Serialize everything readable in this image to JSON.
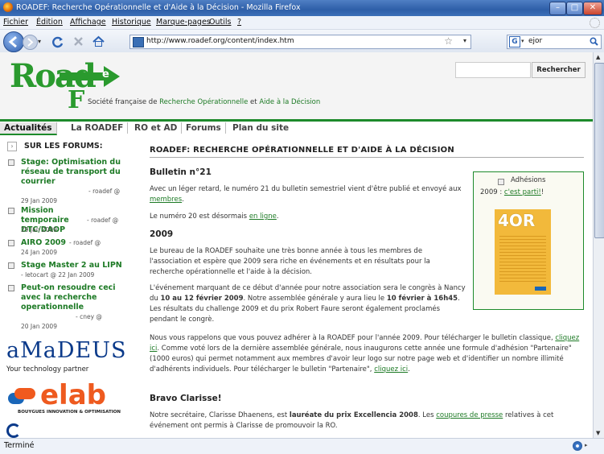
{
  "window": {
    "title": "ROADEF: Recherche Opérationnelle et d'Aide à la Décision - Mozilla Firefox",
    "controls": [
      "minimize",
      "maximize",
      "close"
    ]
  },
  "menu": {
    "items": [
      "Fichier",
      "Édition",
      "Affichage",
      "Historique",
      "Marque-pages",
      "Outils",
      "?"
    ]
  },
  "navbar": {
    "url": "http://www.roadef.org/content/index.htm",
    "search_value": "ejor"
  },
  "site": {
    "logo_text": "Road",
    "logo_letters": [
      "e",
      "F"
    ],
    "tagline_prefix": "Société française de ",
    "tagline_green1": "Recherche Opérationnelle",
    "tagline_mid": " et ",
    "tagline_green2": "Aide à la Décision",
    "search_button": "Rechercher"
  },
  "tabs": [
    "Actualités",
    "La ROADEF",
    "RO et AD",
    "Forums",
    "Plan du site"
  ],
  "sidebar": {
    "heading": "SUR LES FORUMS:",
    "items": [
      {
        "title": "Stage: Optimisation du réseau de transport du courrier",
        "author": " - roadef @",
        "date": "29 Jan 2009"
      },
      {
        "title": "Mission temporaire DTC/DAOP",
        "author": " - roadef @",
        "date": "29 Jan 2009"
      },
      {
        "title": "AIRO 2009",
        "author": " - roadef @",
        "date": "24 Jan 2009"
      },
      {
        "title": "Stage Master 2 au LIPN",
        "author": "- letocart @ 22 Jan 2009",
        "date": ""
      },
      {
        "title": "Peut-on resoudre ceci avec la recherche operationnelle",
        "author": " - cney @",
        "date": "20 Jan 2009"
      }
    ],
    "sponsor1": "aMaDEUS",
    "sponsor1_tag": "Your technology partner",
    "sponsor2": "elab",
    "sponsor2_tag": "BOUYGUES INNOVATION & OPTIMISATION"
  },
  "main": {
    "heading": "ROADEF: RECHERCHE OPÉRATIONNELLE ET D'AIDE À LA DÉCISION",
    "bulletin_title": "Bulletin n°21",
    "bulletin_p1a": "Avec un léger retard, le numéro 21 du bulletin semestriel vient d'être publié et envoyé aux ",
    "bulletin_p1_link": "membres",
    "bulletin_p1b": ".",
    "bulletin_p2a": "Le numéro 20 est désormais ",
    "bulletin_p2_link": "en ligne",
    "bulletin_p2b": ".",
    "y2009_title": "2009",
    "y2009_p1": "Le bureau de la ROADEF souhaite une très bonne année à tous les membres de l'association et espère que 2009 sera riche en événements et en résultats pour la recherche opérationnelle et l'aide à la décision.",
    "y2009_p2a": "L'événement marquant de ce début d'année pour notre association sera le congrès à Nancy du ",
    "y2009_p2b": "10 au 12 février 2009",
    "y2009_p2c": ". Notre assemblée générale y aura lieu le ",
    "y2009_p2d": "10 février à 16h45",
    "y2009_p2e": ". Les résultats du challenge 2009 et du prix Robert Faure seront également proclamés pendant le congrè.",
    "y2009_p3a": "Nous vous rappelons que vous pouvez adhérer à la ROADEF pour l'année 2009. Pour télécharger le bulletin classique, ",
    "y2009_p3_link1": "cliquez ici",
    "y2009_p3b": ". Comme voté lors de la dernière assemblée générale, nous inaugurons cette année une formule d'adhésion \"Partenaire\" (1000 euros) qui permet notamment aux membres d'avoir leur logo sur notre page web et d'identifier un nombre illimité d'adhérents individuels. Pour télécharger le bulletin \"Partenaire\", ",
    "y2009_p3_link2": "cliquez ici",
    "y2009_p3c": ".",
    "bravo_title": "Bravo Clarisse!",
    "bravo_pa": "Notre secrétaire, Clarisse Dhaenens, est ",
    "bravo_pb": "lauréate du prix Excellencia 2008",
    "bravo_pc": ". Les ",
    "bravo_link": "coupures de presse",
    "bravo_pd": " relatives à cet événement ont permis à Clarisse de promouvoir la RO.",
    "adhesions_a": "Adhésions",
    "adhesions_b": "2009 : ",
    "adhesions_link": "c'est parti!",
    "adhesions_c": "!",
    "book_title": "4OR"
  },
  "status": {
    "text": "Terminé"
  },
  "colors": {
    "green": "#1d8a2b",
    "link": "#1d7a25"
  }
}
